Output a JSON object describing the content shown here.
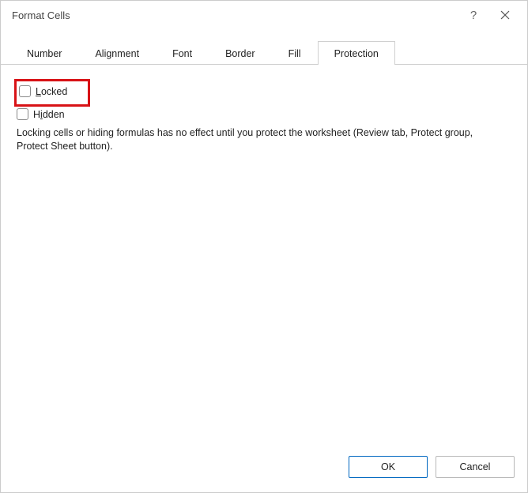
{
  "titlebar": {
    "title": "Format Cells",
    "help_label": "?",
    "close_label": "Close"
  },
  "tabs": [
    {
      "label": "Number"
    },
    {
      "label": "Alignment"
    },
    {
      "label": "Font"
    },
    {
      "label": "Border"
    },
    {
      "label": "Fill"
    },
    {
      "label": "Protection"
    }
  ],
  "protection": {
    "locked_label": "Locked",
    "hidden_label": "Hidden",
    "info_text": "Locking cells or hiding formulas has no effect until you protect the worksheet (Review tab, Protect group, Protect Sheet button)."
  },
  "buttons": {
    "ok": "OK",
    "cancel": "Cancel"
  }
}
